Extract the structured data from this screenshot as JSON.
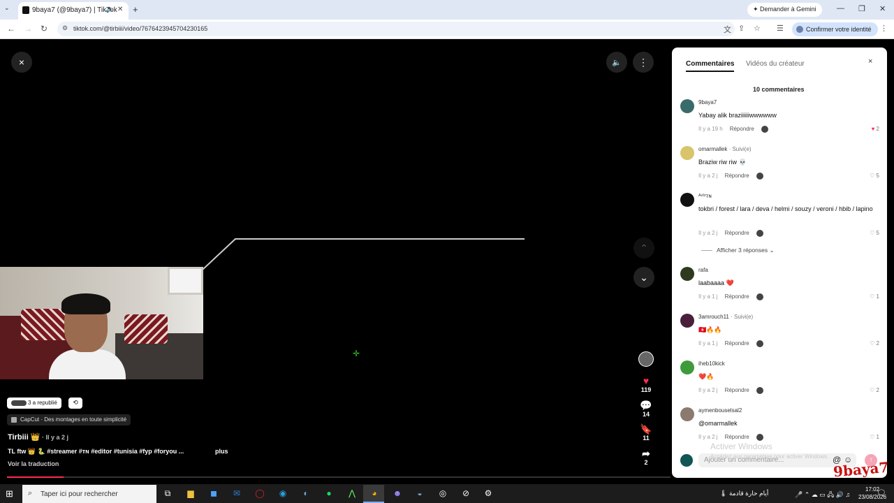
{
  "browser": {
    "tab_title": "9baya7 (@9baya7) | TikTok",
    "new_tab": "+",
    "gemini_label": "Demander à Gemini",
    "url": "tiktok.com/@tirbiii/video/7676423945704230165",
    "identity_label": "Confirmer votre identité"
  },
  "player": {
    "close": "×",
    "volume": "🔈",
    "more": "⋮",
    "up": "⌃",
    "down": "⌄"
  },
  "actions": {
    "likes": "119",
    "comments": "14",
    "saves": "11",
    "shares": "2"
  },
  "info": {
    "reposted": "3 a republié",
    "capcut": "CapCut · Des montages en toute simplicité",
    "author": "Tirbiii 👑",
    "posted": " · Il y a 2 j",
    "caption": "TL ftw 👑 🐍 #streamer #ᴛɴ #editor #tunisia #fyp #foryou ...",
    "more": "plus",
    "translate": "Voir la traduction",
    "progress": 0.085
  },
  "comments_panel": {
    "tab_comments": "Commentaires",
    "tab_creator": "Vidéos du créateur",
    "close": "×",
    "count": "10 commentaires",
    "reply_label": "Répondre",
    "show_replies": "Afficher 3 réponses ⌄",
    "input_placeholder": "Ajouter un commentaire...",
    "items": [
      {
        "user": "9baya7",
        "followed": "",
        "text": "Yabay alik braziiiiiiwwwwww",
        "time": "Il y a 19 h",
        "likes": "2",
        "liked": true
      },
      {
        "user": "omarmallek",
        "followed": " · Suivi(e)",
        "text": "Braziw riw riw 💀",
        "time": "Il y a 2 j",
        "likes": "5",
        "liked": false
      },
      {
        "user": "ᴬᶻᴵᶻᴛɴ",
        "followed": "",
        "text": "tokbri / forest / lara / deva / helmi / souzy / veroni / hbib / lapino",
        "time": "Il y a 2 j",
        "likes": "5",
        "liked": false
      },
      {
        "user": "rafa",
        "followed": "",
        "text": "laabaaaa ❤️",
        "time": "Il y a 1 j",
        "likes": "1",
        "liked": false
      },
      {
        "user": "3amrouch11",
        "followed": " · Suivi(e)",
        "text": "🇹🇳🔥🔥",
        "time": "Il y a 1 j",
        "likes": "2",
        "liked": false
      },
      {
        "user": "iheb10kick",
        "followed": "",
        "text": "❤️🔥",
        "time": "Il y a 2 j",
        "likes": "2",
        "liked": false
      },
      {
        "user": "aymenbouselsal2",
        "followed": "",
        "text": "@omarmallek",
        "time": "Il y a 2 j",
        "likes": "1",
        "liked": false
      }
    ]
  },
  "windows": {
    "activate_title": "Activer Windows",
    "activate_sub": "Accédez aux paramètres pour activer Windows.",
    "watermark": "9baya7"
  },
  "taskbar": {
    "search_placeholder": "Taper ici pour rechercher",
    "weather": "أيام حارة قادمة",
    "time": "17:02",
    "date": "23/08/2026"
  }
}
